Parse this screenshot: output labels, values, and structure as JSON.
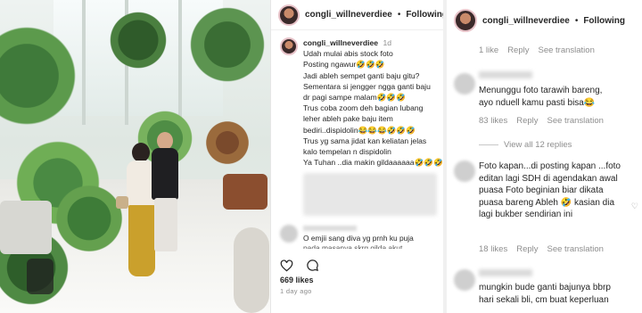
{
  "post": {
    "username": "congli_willneverdiee",
    "follow_label": "Following",
    "separator": "•",
    "caption_time": "1d",
    "caption_lines": [
      "Udah mulai abis stock foto",
      "Posting ngawur🤣🤣🤣",
      "Jadi ableh sempet ganti baju gitu?",
      "Sementara si jengger ngga ganti baju",
      "dr pagi sampe malam🤣🤣🤣",
      "Trus coba zoom deh bagian lubang",
      "leher ableh pake baju item",
      "bediri..dispidolin😂😂😂🤣🤣🤣",
      "Trus yg sama jidat kan keliatan jelas",
      "kalo tempelan n dispidolin",
      "Ya Tuhan ..dia makin gildaaaaaa🤣🤣🤣🤣🤣"
    ],
    "comment_1": "O emjii sang diva yg prnh ku puja",
    "comment_2": "pada masanya skrg gilda akut",
    "likes": "669 likes",
    "posted": "1 day ago"
  },
  "comments": {
    "username": "congli_willneverdiee",
    "follow_label": "Following",
    "separator": "•",
    "reply_label": "Reply",
    "see_translation": "See translation",
    "top_meta_likes": "1 like",
    "items": [
      {
        "lines": [
          "Menunggu foto tarawih bareng,",
          "ayo nduell kamu pasti bisa😂"
        ],
        "likes": "83 likes"
      },
      {
        "lines": [
          "Foto kapan...di posting kapan ...foto",
          "editan lagi SDH di agendakan awal",
          "puasa Foto beginian biar dikata",
          "puasa bareng Ableh 🤣 kasian dia",
          "lagi bukber sendirian ini"
        ],
        "likes": "18 likes"
      },
      {
        "lines": [
          "mungkin bude ganti bajunya bbrp",
          "hari sekali bli, cm buat keperluan"
        ],
        "likes": ""
      }
    ],
    "view_replies": "View all 12 replies"
  },
  "icons": [
    "more-icon",
    "heart-icon",
    "comment-icon",
    "share-icon",
    "bookmark-icon"
  ]
}
